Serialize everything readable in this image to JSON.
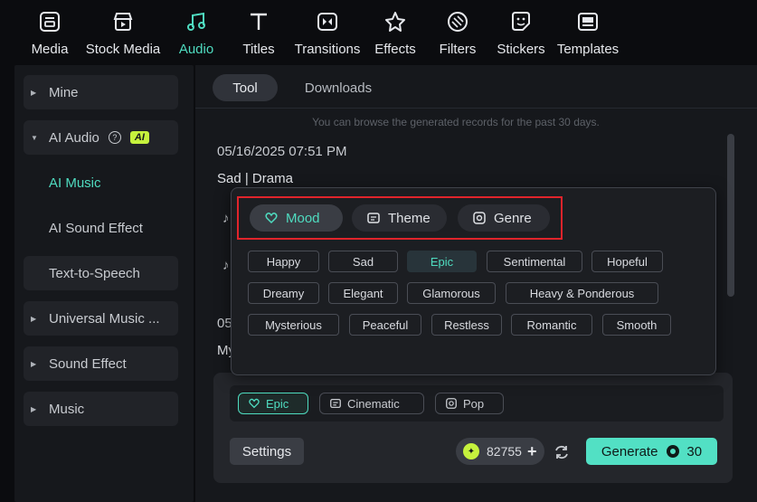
{
  "toolbar": {
    "items": [
      {
        "label": "Media",
        "icon": "media-icon"
      },
      {
        "label": "Stock Media",
        "icon": "stock-media-icon"
      },
      {
        "label": "Audio",
        "icon": "audio-icon"
      },
      {
        "label": "Titles",
        "icon": "titles-icon"
      },
      {
        "label": "Transitions",
        "icon": "transitions-icon"
      },
      {
        "label": "Effects",
        "icon": "effects-icon"
      },
      {
        "label": "Filters",
        "icon": "filters-icon"
      },
      {
        "label": "Stickers",
        "icon": "stickers-icon"
      },
      {
        "label": "Templates",
        "icon": "templates-icon"
      }
    ],
    "active": "Audio"
  },
  "sidebar": {
    "mine": "Mine",
    "ai_audio": "AI Audio",
    "ai_badge": "AI",
    "ai_music": "AI Music",
    "ai_sound_effect": "AI Sound Effect",
    "text_to_speech": "Text-to-Speech",
    "universal_music": "Universal Music ...",
    "sound_effect": "Sound Effect",
    "music": "Music"
  },
  "tabs": {
    "tool": "Tool",
    "downloads": "Downloads"
  },
  "notice": "You can browse the generated records for the past 30 days.",
  "records": [
    {
      "date": "05/16/2025 07:51 PM",
      "tags": "Sad | Drama"
    },
    {
      "date": "05",
      "tags": "My"
    }
  ],
  "popup": {
    "categories": [
      {
        "label": "Mood",
        "icon": "mood-icon"
      },
      {
        "label": "Theme",
        "icon": "theme-icon"
      },
      {
        "label": "Genre",
        "icon": "genre-icon"
      }
    ],
    "active_category": "Mood",
    "moods_row1": [
      "Happy",
      "Sad",
      "Epic",
      "Sentimental",
      "Hopeful"
    ],
    "moods_row2": [
      "Dreamy",
      "Elegant",
      "Glamorous",
      "Heavy & Ponderous"
    ],
    "moods_row3": [
      "Mysterious",
      "Peaceful",
      "Restless",
      "Romantic",
      "Smooth"
    ],
    "selected_mood": "Epic"
  },
  "generate": {
    "chips": [
      {
        "label": "Epic",
        "icon": "mood-icon"
      },
      {
        "label": "Cinematic",
        "icon": "theme-icon"
      },
      {
        "label": "Pop",
        "icon": "genre-icon"
      }
    ],
    "settings_label": "Settings",
    "credits": "82755",
    "generate_label": "Generate",
    "cost": "30"
  },
  "colors": {
    "accent": "#4fdcc0",
    "generate": "#52e0c4",
    "ai_badge": "#c6f23d",
    "highlight_frame": "#e0242b"
  }
}
